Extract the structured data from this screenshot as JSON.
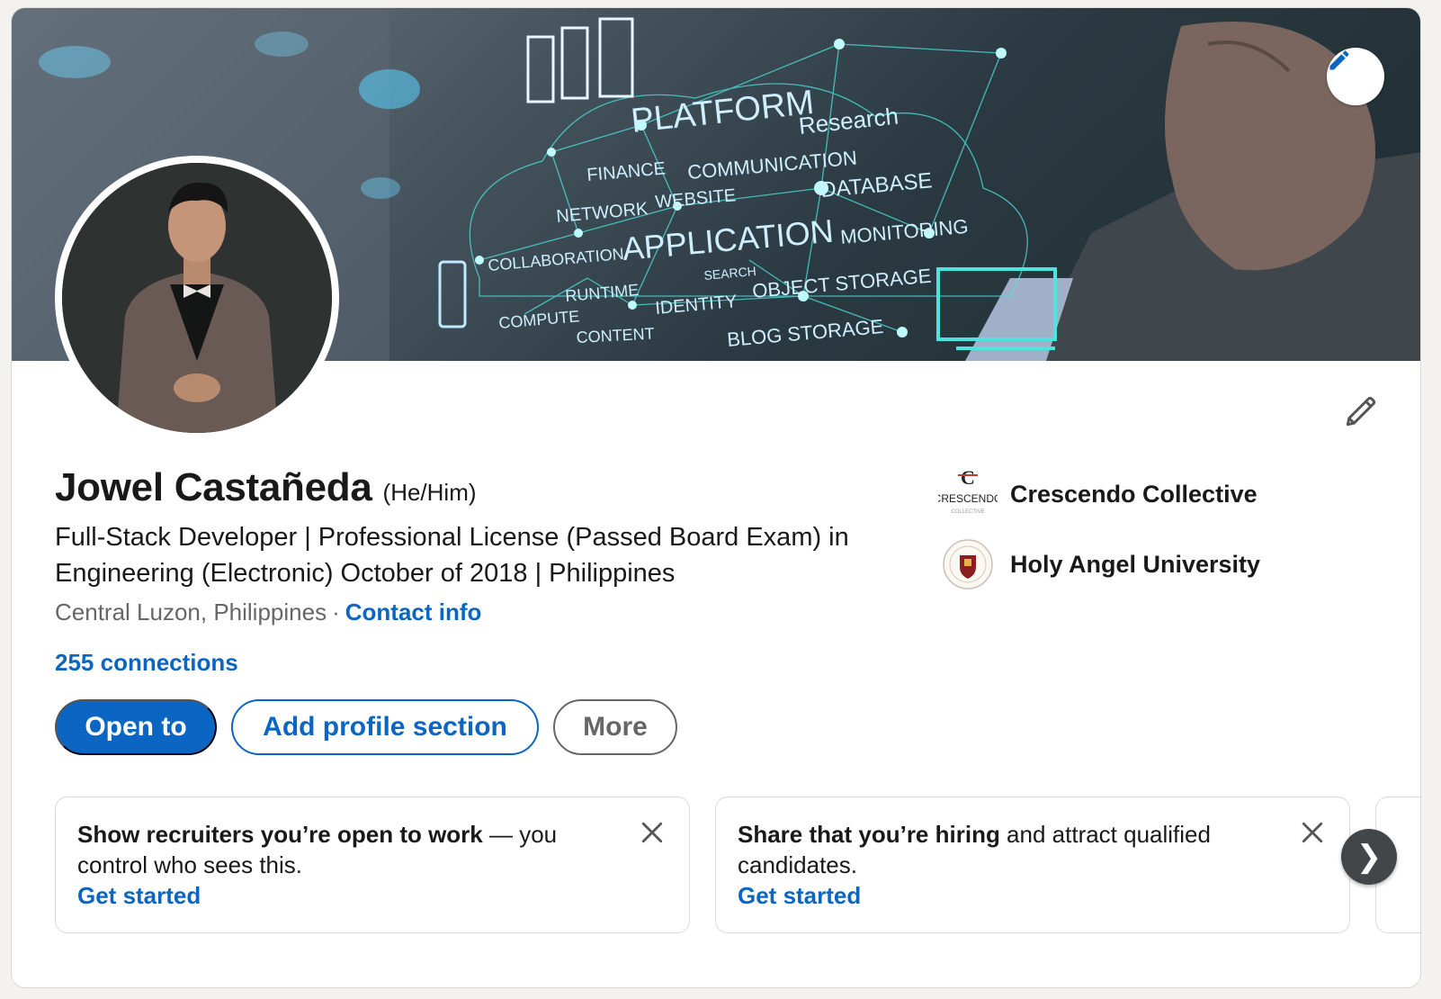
{
  "profile": {
    "name": "Jowel Castañeda",
    "pronouns": "(He/Him)",
    "headline": "Full-Stack Developer | Professional License (Passed Board Exam) in Engineering (Electronic) October of 2018 | Philippines",
    "location": "Central Luzon, Philippines",
    "separator": "·",
    "contact_info_label": "Contact info",
    "connections": "255 connections"
  },
  "banner": {
    "words": [
      "PLATFORM",
      "Research",
      "FINANCE",
      "COMMUNICATION",
      "NETWORK",
      "WEBSITE",
      "DATABASE",
      "APPLICATION",
      "MONITORING",
      "COLLABORATION",
      "SEARCH",
      "RUNTIME",
      "IDENTITY",
      "OBJECT STORAGE",
      "COMPUTE",
      "CONTENT",
      "BLOG STORAGE"
    ]
  },
  "actions": {
    "open_to": "Open to",
    "add_section": "Add profile section",
    "more": "More"
  },
  "organizations": [
    {
      "name": "Crescendo Collective",
      "logo_text": "CRESCENDO",
      "logo_subtext": "COLLECTIVE",
      "logo_mark": "C"
    },
    {
      "name": "Holy Angel University"
    }
  ],
  "promos": [
    {
      "bold": "Show recruiters you’re open to work",
      "rest": " — you control who sees this.",
      "cta": "Get started"
    },
    {
      "bold": "Share that you’re hiring",
      "rest": " and attract qualified candidates.",
      "cta": "Get started"
    }
  ],
  "carousel": {
    "next_glyph": "❯"
  },
  "icons": {
    "banner_edit": "pencil-icon",
    "profile_edit": "pencil-icon",
    "close": "close-icon"
  },
  "colors": {
    "brand_blue": "#0a66c2",
    "text": "#191919",
    "secondary_text": "#666666",
    "banner_line": "#4fe3e0"
  }
}
